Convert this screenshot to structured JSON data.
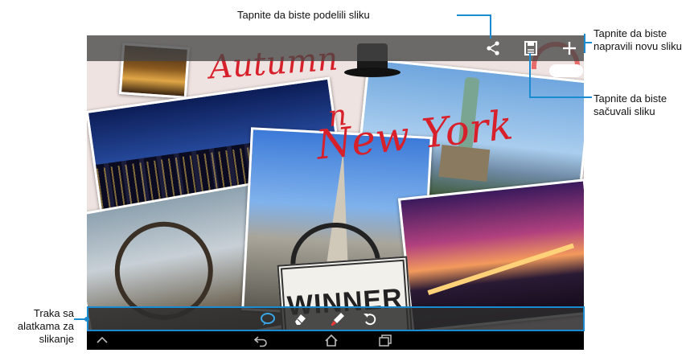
{
  "topbar": {
    "icons": [
      "share-icon",
      "save-icon",
      "plus-icon"
    ]
  },
  "drawing": {
    "scribbles": [
      "Autumn",
      "n",
      "New York"
    ],
    "stamp_text": "WINNER"
  },
  "toolbar": {
    "tools": [
      "speech-bubble-icon",
      "eraser-icon",
      "brush-icon",
      "undo-icon"
    ]
  },
  "navbar": {
    "icons": [
      "up-chevron-icon",
      "back-icon",
      "home-icon",
      "recent-apps-icon"
    ]
  },
  "callouts": {
    "share": "Tapnite da biste podelili sliku",
    "new": "Tapnite da biste napravili novu sliku",
    "save": "Tapnite da biste sačuvali sliku",
    "toolbar": "Traka sa alatkama za slikanje"
  },
  "colors": {
    "accent": "#1a8bd0",
    "scribble": "#d8202a"
  }
}
